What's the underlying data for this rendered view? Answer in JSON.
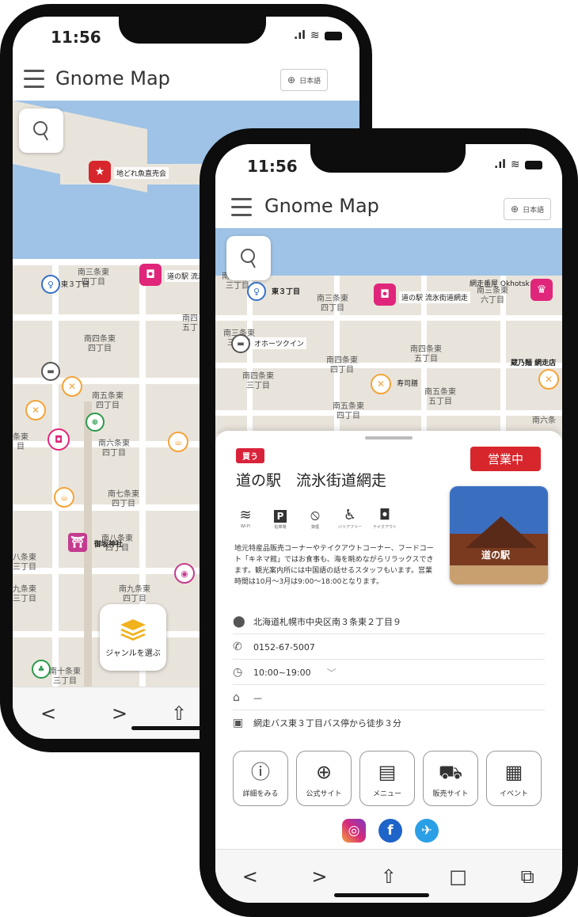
{
  "back_phone": {
    "status_time": "11:56",
    "app_title": "Gnome Map",
    "lang_label": "日本語",
    "map": {
      "pins": [
        {
          "label": "地どれ魚直売会"
        },
        {
          "label": "道の駅 流氷"
        },
        {
          "label": "東３丁目"
        },
        {
          "label": "御坂神社"
        }
      ],
      "streets": [
        "南三条東\n四丁目",
        "南四条東\n四丁目",
        "南五条東\n四丁目",
        "南六条東\n四丁目",
        "南七条東\n四丁目",
        "南八条東\n四丁目",
        "南九条東\n四丁目",
        "南十条東\n三丁目",
        "八条東\n三丁目",
        "九条東\n三丁目",
        "条東\n目",
        "南四\n五丁"
      ]
    },
    "genre_button_label": "ジャンルを選ぶ",
    "nav": [
      "<",
      ">",
      "⇧"
    ]
  },
  "front_phone": {
    "status_time": "11:56",
    "app_title": "Gnome Map",
    "lang_label": "日本語",
    "map": {
      "pins": [
        {
          "label": "東３丁目"
        },
        {
          "label": "道の駅 流氷街道網走"
        },
        {
          "label": "網走番屋 Okhotsk Mark"
        },
        {
          "label": "オホーツクイン"
        },
        {
          "label": "寿司膳"
        },
        {
          "label": "蔵乃麺 網走店"
        }
      ],
      "streets": [
        "南三条東\n三丁目",
        "南三条東\n四丁目",
        "南三条東\n六丁目",
        "南三条東\n三丁目",
        "南四条東\n五丁目",
        "南四条東\n四丁目",
        "南四条東\n三丁目",
        "南五条東\n四丁目",
        "南五条東\n五丁目",
        "南六条"
      ]
    },
    "detail": {
      "category_tag": "買う",
      "status_badge": "営業中",
      "name": "道の駅　流氷街道網走",
      "amenities": [
        {
          "icon": "wifi-icon",
          "caption": "Wi-Fi"
        },
        {
          "icon": "parking-icon",
          "caption": "駐車場"
        },
        {
          "icon": "no-smoking-icon",
          "caption": "禁煙"
        },
        {
          "icon": "accessible-icon",
          "caption": "バリアフリー"
        },
        {
          "icon": "takeout-icon",
          "caption": "テイクアウト"
        }
      ],
      "description": "地元特産品販売コーナーやテイクアウトコーナー、フードコート「キネマ館」ではお食事も、海を眺めながらリラックスできます。観光案内所には中国語の話せるスタッフもいます。営業時間は10月～3月は9:00～18:00となります。",
      "photo_sign": "道の駅",
      "address": "北海道札幌市中央区南３条東２丁目９",
      "phone": "0152-67-5007",
      "hours": "10:00~19:00",
      "price": "—",
      "access": "網走バス東３丁目バス停から徒歩３分",
      "actions": [
        {
          "icon": "info-icon",
          "label": "詳細をみる"
        },
        {
          "icon": "globe-icon",
          "label": "公式サイト"
        },
        {
          "icon": "menu-icon",
          "label": "メニュー"
        },
        {
          "icon": "cart-icon",
          "label": "販売サイト"
        },
        {
          "icon": "calendar-icon",
          "label": "イベント"
        }
      ],
      "social": [
        "instagram-icon",
        "facebook-icon",
        "twitter-icon"
      ]
    },
    "nav": [
      "<",
      ">",
      "⇧",
      "□",
      "⧉"
    ]
  },
  "colors": {
    "red": "#d7262c",
    "pink": "#e0267a",
    "sea": "#9ec3e6",
    "orange": "#f3a43a"
  }
}
